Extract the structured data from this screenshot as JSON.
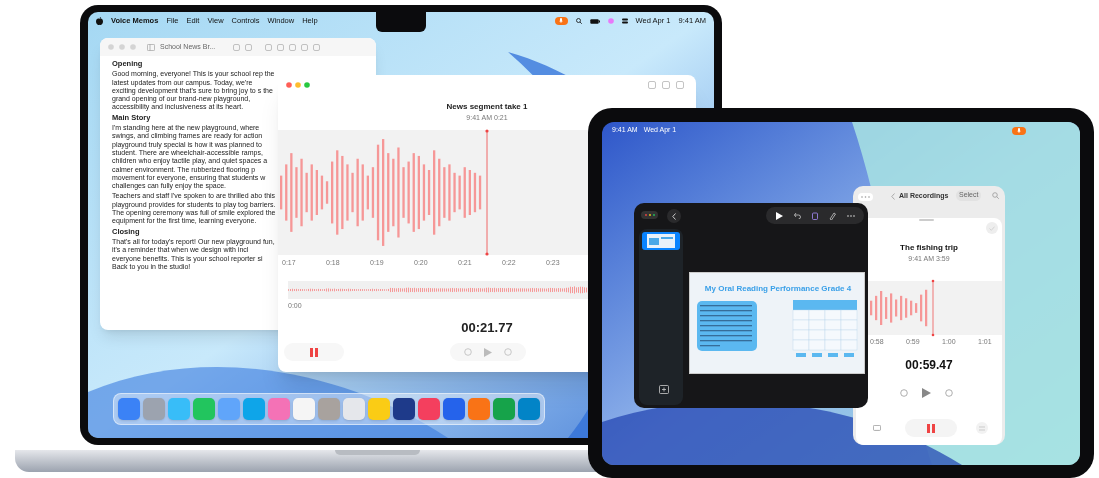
{
  "macbook": {
    "menu_bar": {
      "app_name": "Voice Memos",
      "menus": [
        "File",
        "Edit",
        "View",
        "Controls",
        "Window",
        "Help"
      ],
      "date": "Wed Apr 1",
      "time": "9:41 AM"
    },
    "document_window": {
      "title": "School News Br...",
      "sections": [
        {
          "heading": "Opening",
          "paragraphs": [
            "Good morning, everyone! This is your school rep the latest updates from our campus. Today, we're exciting development that's sure to bring joy to s the grand opening of our brand-new playground, accessibility and inclusiveness at its heart."
          ]
        },
        {
          "heading": "Main Story",
          "paragraphs": [
            "I'm standing here at the new playground, where swings, and climbing frames are ready for action playground truly special is how it was planned to student. There are wheelchair-accessible ramps, children who enjoy tactile play, and quiet spaces a calmer environment. The rubberized flooring p movement for everyone, ensuring that students w challenges can fully enjoy the space.",
            "Teachers and staff I've spoken to are thrilled abo this playground provides for students to play tog barriers. The opening ceremony was full of smile explored the equipment for the first time, learning everyone."
          ]
        },
        {
          "heading": "Closing",
          "paragraphs": [
            "That's all for today's report! Our new playground fun, it's a reminder that when we design with incl everyone benefits. This is your school reporter si Back to you in the studio!"
          ]
        }
      ]
    },
    "voice_memos_window": {
      "title": "News segment take 1",
      "subtitle": "9:41 AM  0:21",
      "ticks": [
        "0:17",
        "0:18",
        "0:19",
        "0:20",
        "0:21",
        "0:22",
        "0:23"
      ],
      "overview_start": "0:00",
      "elapsed": "00:21.77"
    },
    "dock": {
      "apps": [
        {
          "color": "#3b82f6"
        },
        {
          "color": "#9ca3af"
        },
        {
          "color": "#38bdf8"
        },
        {
          "color": "#22c55e"
        },
        {
          "color": "#60a5fa"
        },
        {
          "color": "#0ea5e9"
        },
        {
          "color": "#f472b6"
        },
        {
          "color": "#f5f5f5"
        },
        {
          "color": "#a8a29e"
        },
        {
          "color": "#e5e7eb"
        },
        {
          "color": "#facc15"
        },
        {
          "color": "#1e3a8a"
        },
        {
          "color": "#f43f5e"
        },
        {
          "color": "#2563eb"
        },
        {
          "color": "#f97316"
        },
        {
          "color": "#16a34a"
        },
        {
          "color": "#0284c7"
        }
      ]
    }
  },
  "ipad": {
    "status_bar": {
      "time": "9:41 AM",
      "date": "Wed Apr 1"
    },
    "keynote_window": {
      "slide_title": "My Oral Reading Performance Grade 4"
    },
    "voice_memos_window": {
      "nav_title": "All Recordings",
      "select": "Select",
      "title": "The fishing trip",
      "subtitle": "9:41 AM  3:59",
      "ticks": [
        "0:58",
        "0:59",
        "1:00",
        "1:01"
      ],
      "elapsed": "00:59.47"
    }
  }
}
